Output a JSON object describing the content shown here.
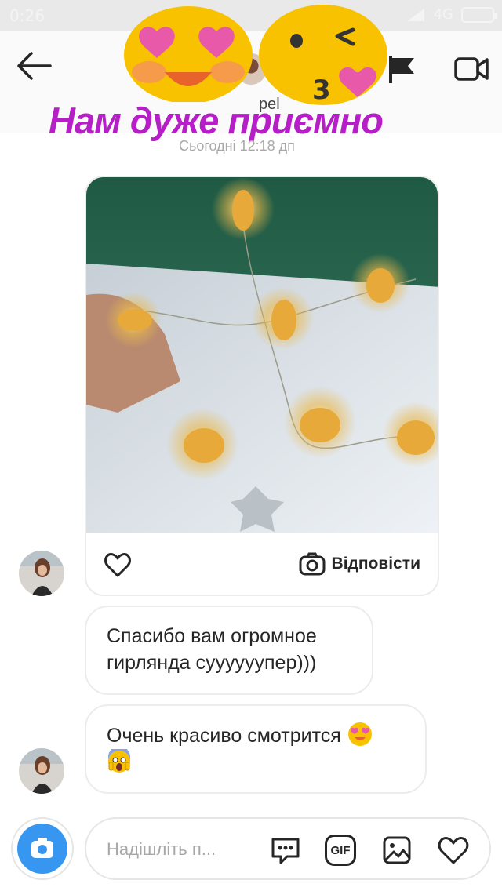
{
  "status_bar": {
    "time": "0:26",
    "network": "4G"
  },
  "header": {
    "username": "pel"
  },
  "overlay": {
    "caption": "Нам дуже приємно"
  },
  "thread": {
    "timestamp": "Сьогодні 12:18 дп"
  },
  "post": {
    "reply_label": "Відповісти"
  },
  "messages": [
    {
      "lines": [
        "Спасибо вам огромное",
        "гирлянда суууууупер)))"
      ]
    },
    {
      "lines": [
        "Очень красиво смотрится"
      ]
    }
  ],
  "composer": {
    "placeholder": "Надішліть п..."
  },
  "icons": {
    "back": "arrow-left-icon",
    "flag": "flag-icon",
    "video": "video-camera-icon",
    "like": "heart-icon",
    "reply": "camera-icon",
    "more": "message-dots-icon",
    "gif": "GIF",
    "gallery": "image-icon",
    "heart": "heart-icon"
  },
  "colors": {
    "accent": "#3797f0",
    "caption": "#b61ec7",
    "sticker": "#f9c200"
  }
}
